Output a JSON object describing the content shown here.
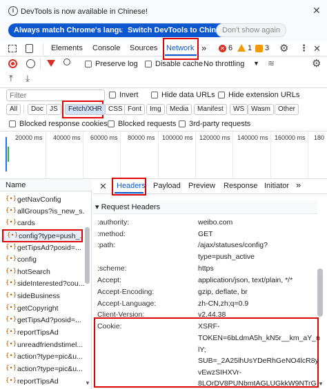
{
  "infobar": {
    "message": "DevTools is now available in Chinese!",
    "btn_match": "Always match Chrome's language",
    "btn_switch": "Switch DevTools to Chinese",
    "btn_dismiss": "Don't show again"
  },
  "toolbar": {
    "tabs": [
      "Elements",
      "Console",
      "Sources",
      "Network"
    ],
    "more": "»",
    "errors": "6",
    "warnings": "1",
    "issues": "3"
  },
  "network_controls": {
    "preserve_log": "Preserve log",
    "disable_cache": "Disable cache",
    "throttling": "No throttling"
  },
  "filter": {
    "placeholder": "Filter",
    "invert": "Invert",
    "hide_data_urls": "Hide data URLs",
    "hide_extension_urls": "Hide extension URLs",
    "types": [
      "All",
      "Doc",
      "JS",
      "Fetch/XHR",
      "CSS",
      "Font",
      "Img",
      "Media",
      "Manifest",
      "WS",
      "Wasm",
      "Other"
    ],
    "blocked_cookies": "Blocked response cookies",
    "blocked_requests": "Blocked requests",
    "third_party": "3rd-party requests"
  },
  "timeline": {
    "ticks": [
      "20000 ms",
      "40000 ms",
      "60000 ms",
      "80000 ms",
      "100000 ms",
      "120000 ms",
      "140000 ms",
      "160000 ms",
      "180"
    ]
  },
  "requests": {
    "header": "Name",
    "items": [
      "getNavConfig",
      "allGroups?is_new_s...",
      "cards",
      "config?type=push_...",
      "getTipsAd?posid=...",
      "config",
      "hotSearch",
      "sideInterested?cou...",
      "sideBusiness",
      "getCopyright",
      "getTipsAd?posid=...",
      "reportTipsAd",
      "unreadfriendstimel...",
      "action?type=pic&u...",
      "action?type=pic&u...",
      "reportTipsAd"
    ]
  },
  "details": {
    "tabs": [
      "Headers",
      "Payload",
      "Preview",
      "Response",
      "Initiator"
    ],
    "more": "»",
    "section": "▾ Request Headers",
    "headers": [
      {
        "name": ":authority:",
        "value": "weibo.com"
      },
      {
        "name": ":method:",
        "value": "GET"
      },
      {
        "name": ":path:",
        "value": "/ajax/statuses/config?"
      },
      {
        "name": "",
        "value": "type=push_active"
      },
      {
        "name": ":scheme:",
        "value": "https"
      },
      {
        "name": "Accept:",
        "value": "application/json, text/plain, */*"
      },
      {
        "name": "Accept-Encoding:",
        "value": "gzip, deflate, br"
      },
      {
        "name": "Accept-Language:",
        "value": "zh-CN,zh;q=0.9"
      },
      {
        "name": "Client-Version:",
        "value": "v2.44.38"
      }
    ],
    "cookie_name": "Cookie:",
    "cookie_lines": [
      "XSRF-",
      "TOKEN=6bLdmA5h_kN5r__km_aY_n",
      "lY;",
      "SUB=_2A25lhUsYDeRhGeNO4lcR8y",
      "vEwzSIHXVr-",
      "8LOrDV8PUNbmtAGLUGkkW9NTrG"
    ]
  }
}
